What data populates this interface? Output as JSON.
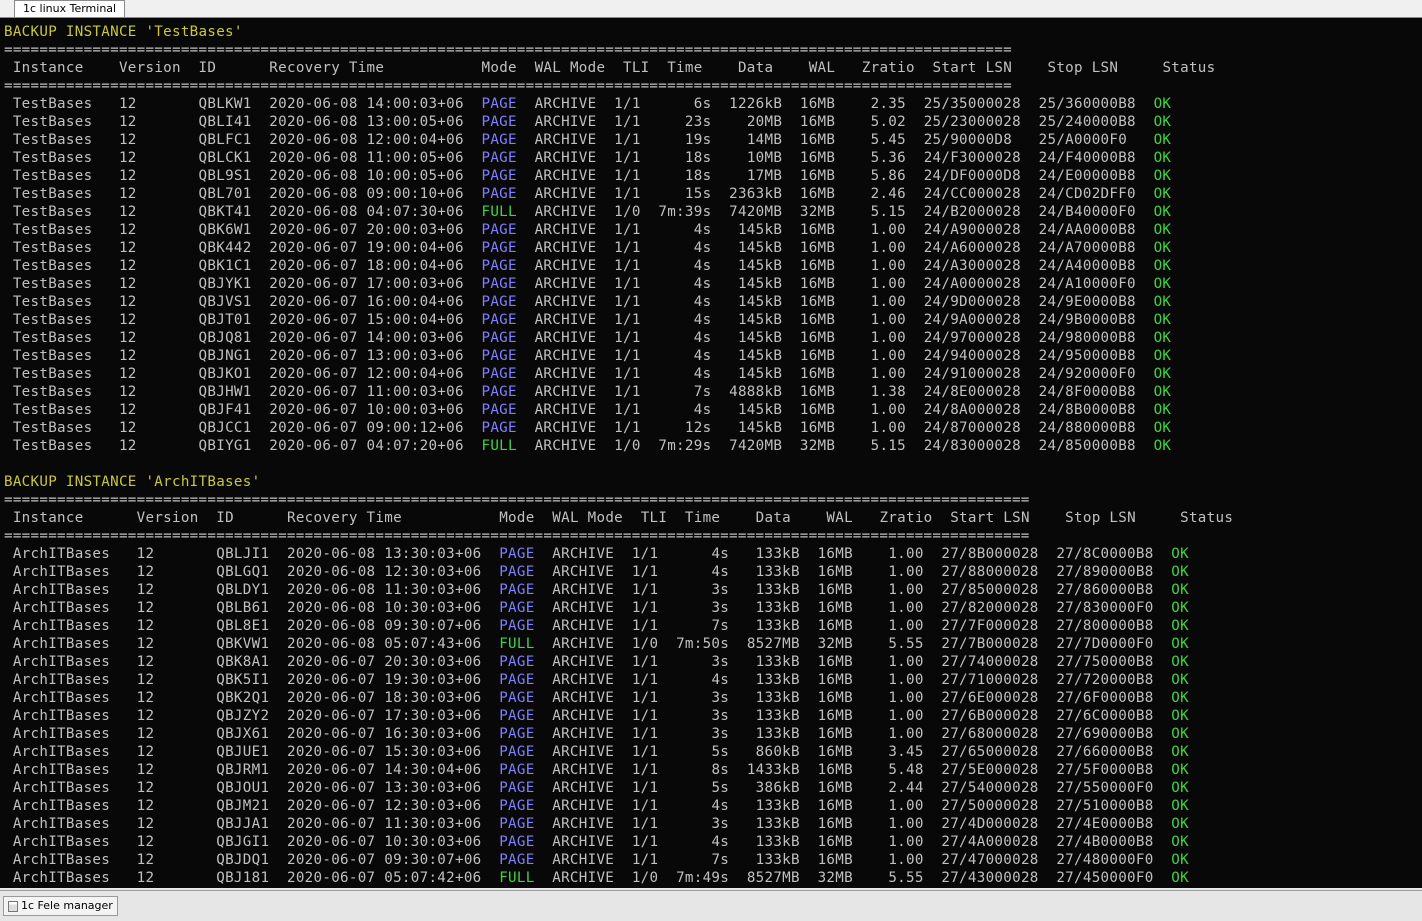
{
  "tabs": {
    "terminal_label": "1c linux Terminal",
    "filemanager_label": "1c Fele manager"
  },
  "colors": {
    "background": "#080808",
    "text": "#c0c0c0",
    "header": "#c9c83a",
    "mode_page": "#8080ff",
    "mode_full": "#3ed63e",
    "status_ok": "#3ed63e"
  },
  "instances": [
    {
      "heading": "BACKUP INSTANCE 'TestBases'",
      "name_width": 10,
      "separator_length": 114,
      "headers": [
        "Instance",
        "Version",
        "ID",
        "Recovery Time",
        "Mode",
        "WAL Mode",
        "TLI",
        "Time",
        "Data",
        "WAL",
        "Zratio",
        "Start LSN",
        "Stop LSN",
        "Status"
      ],
      "rows": [
        [
          "TestBases",
          "12",
          "QBLKW1",
          "2020-06-08 14:00:03+06",
          "PAGE",
          "ARCHIVE",
          "1/1",
          "6s",
          "1226kB",
          "16MB",
          "2.35",
          "25/35000028",
          "25/360000B8",
          "OK"
        ],
        [
          "TestBases",
          "12",
          "QBLI41",
          "2020-06-08 13:00:05+06",
          "PAGE",
          "ARCHIVE",
          "1/1",
          "23s",
          "20MB",
          "16MB",
          "5.02",
          "25/23000028",
          "25/240000B8",
          "OK"
        ],
        [
          "TestBases",
          "12",
          "QBLFC1",
          "2020-06-08 12:00:04+06",
          "PAGE",
          "ARCHIVE",
          "1/1",
          "19s",
          "14MB",
          "16MB",
          "5.45",
          "25/90000D8",
          "25/A0000F0",
          "OK"
        ],
        [
          "TestBases",
          "12",
          "QBLCK1",
          "2020-06-08 11:00:05+06",
          "PAGE",
          "ARCHIVE",
          "1/1",
          "18s",
          "10MB",
          "16MB",
          "5.36",
          "24/F3000028",
          "24/F40000B8",
          "OK"
        ],
        [
          "TestBases",
          "12",
          "QBL9S1",
          "2020-06-08 10:00:05+06",
          "PAGE",
          "ARCHIVE",
          "1/1",
          "18s",
          "17MB",
          "16MB",
          "5.86",
          "24/DF0000D8",
          "24/E00000B8",
          "OK"
        ],
        [
          "TestBases",
          "12",
          "QBL701",
          "2020-06-08 09:00:10+06",
          "PAGE",
          "ARCHIVE",
          "1/1",
          "15s",
          "2363kB",
          "16MB",
          "2.46",
          "24/CC000028",
          "24/CD02DFF0",
          "OK"
        ],
        [
          "TestBases",
          "12",
          "QBKT41",
          "2020-06-08 04:07:30+06",
          "FULL",
          "ARCHIVE",
          "1/0",
          "7m:39s",
          "7420MB",
          "32MB",
          "5.15",
          "24/B2000028",
          "24/B40000F0",
          "OK"
        ],
        [
          "TestBases",
          "12",
          "QBK6W1",
          "2020-06-07 20:00:03+06",
          "PAGE",
          "ARCHIVE",
          "1/1",
          "4s",
          "145kB",
          "16MB",
          "1.00",
          "24/A9000028",
          "24/AA0000B8",
          "OK"
        ],
        [
          "TestBases",
          "12",
          "QBK442",
          "2020-06-07 19:00:04+06",
          "PAGE",
          "ARCHIVE",
          "1/1",
          "4s",
          "145kB",
          "16MB",
          "1.00",
          "24/A6000028",
          "24/A70000B8",
          "OK"
        ],
        [
          "TestBases",
          "12",
          "QBK1C1",
          "2020-06-07 18:00:04+06",
          "PAGE",
          "ARCHIVE",
          "1/1",
          "4s",
          "145kB",
          "16MB",
          "1.00",
          "24/A3000028",
          "24/A40000B8",
          "OK"
        ],
        [
          "TestBases",
          "12",
          "QBJYK1",
          "2020-06-07 17:00:03+06",
          "PAGE",
          "ARCHIVE",
          "1/1",
          "4s",
          "145kB",
          "16MB",
          "1.00",
          "24/A0000028",
          "24/A10000F0",
          "OK"
        ],
        [
          "TestBases",
          "12",
          "QBJVS1",
          "2020-06-07 16:00:04+06",
          "PAGE",
          "ARCHIVE",
          "1/1",
          "4s",
          "145kB",
          "16MB",
          "1.00",
          "24/9D000028",
          "24/9E0000B8",
          "OK"
        ],
        [
          "TestBases",
          "12",
          "QBJT01",
          "2020-06-07 15:00:04+06",
          "PAGE",
          "ARCHIVE",
          "1/1",
          "4s",
          "145kB",
          "16MB",
          "1.00",
          "24/9A000028",
          "24/9B0000B8",
          "OK"
        ],
        [
          "TestBases",
          "12",
          "QBJQ81",
          "2020-06-07 14:00:03+06",
          "PAGE",
          "ARCHIVE",
          "1/1",
          "4s",
          "145kB",
          "16MB",
          "1.00",
          "24/97000028",
          "24/980000B8",
          "OK"
        ],
        [
          "TestBases",
          "12",
          "QBJNG1",
          "2020-06-07 13:00:03+06",
          "PAGE",
          "ARCHIVE",
          "1/1",
          "4s",
          "145kB",
          "16MB",
          "1.00",
          "24/94000028",
          "24/950000B8",
          "OK"
        ],
        [
          "TestBases",
          "12",
          "QBJKO1",
          "2020-06-07 12:00:04+06",
          "PAGE",
          "ARCHIVE",
          "1/1",
          "4s",
          "145kB",
          "16MB",
          "1.00",
          "24/91000028",
          "24/920000F0",
          "OK"
        ],
        [
          "TestBases",
          "12",
          "QBJHW1",
          "2020-06-07 11:00:03+06",
          "PAGE",
          "ARCHIVE",
          "1/1",
          "7s",
          "4888kB",
          "16MB",
          "1.38",
          "24/8E000028",
          "24/8F0000B8",
          "OK"
        ],
        [
          "TestBases",
          "12",
          "QBJF41",
          "2020-06-07 10:00:03+06",
          "PAGE",
          "ARCHIVE",
          "1/1",
          "4s",
          "145kB",
          "16MB",
          "1.00",
          "24/8A000028",
          "24/8B0000B8",
          "OK"
        ],
        [
          "TestBases",
          "12",
          "QBJCC1",
          "2020-06-07 09:00:12+06",
          "PAGE",
          "ARCHIVE",
          "1/1",
          "12s",
          "145kB",
          "16MB",
          "1.00",
          "24/87000028",
          "24/880000B8",
          "OK"
        ],
        [
          "TestBases",
          "12",
          "QBIYG1",
          "2020-06-07 04:07:20+06",
          "FULL",
          "ARCHIVE",
          "1/0",
          "7m:29s",
          "7420MB",
          "32MB",
          "5.15",
          "24/83000028",
          "24/850000B8",
          "OK"
        ]
      ]
    },
    {
      "heading": "BACKUP INSTANCE 'ArchITBases'",
      "name_width": 12,
      "separator_length": 116,
      "headers": [
        "Instance",
        "Version",
        "ID",
        "Recovery Time",
        "Mode",
        "WAL Mode",
        "TLI",
        "Time",
        "Data",
        "WAL",
        "Zratio",
        "Start LSN",
        "Stop LSN",
        "Status"
      ],
      "rows": [
        [
          "ArchITBases",
          "12",
          "QBLJI1",
          "2020-06-08 13:30:03+06",
          "PAGE",
          "ARCHIVE",
          "1/1",
          "4s",
          "133kB",
          "16MB",
          "1.00",
          "27/8B000028",
          "27/8C0000B8",
          "OK"
        ],
        [
          "ArchITBases",
          "12",
          "QBLGQ1",
          "2020-06-08 12:30:03+06",
          "PAGE",
          "ARCHIVE",
          "1/1",
          "4s",
          "133kB",
          "16MB",
          "1.00",
          "27/88000028",
          "27/890000B8",
          "OK"
        ],
        [
          "ArchITBases",
          "12",
          "QBLDY1",
          "2020-06-08 11:30:03+06",
          "PAGE",
          "ARCHIVE",
          "1/1",
          "3s",
          "133kB",
          "16MB",
          "1.00",
          "27/85000028",
          "27/860000B8",
          "OK"
        ],
        [
          "ArchITBases",
          "12",
          "QBLB61",
          "2020-06-08 10:30:03+06",
          "PAGE",
          "ARCHIVE",
          "1/1",
          "3s",
          "133kB",
          "16MB",
          "1.00",
          "27/82000028",
          "27/830000F0",
          "OK"
        ],
        [
          "ArchITBases",
          "12",
          "QBL8E1",
          "2020-06-08 09:30:07+06",
          "PAGE",
          "ARCHIVE",
          "1/1",
          "7s",
          "133kB",
          "16MB",
          "1.00",
          "27/7F000028",
          "27/800000B8",
          "OK"
        ],
        [
          "ArchITBases",
          "12",
          "QBKVW1",
          "2020-06-08 05:07:43+06",
          "FULL",
          "ARCHIVE",
          "1/0",
          "7m:50s",
          "8527MB",
          "32MB",
          "5.55",
          "27/7B000028",
          "27/7D0000F0",
          "OK"
        ],
        [
          "ArchITBases",
          "12",
          "QBK8A1",
          "2020-06-07 20:30:03+06",
          "PAGE",
          "ARCHIVE",
          "1/1",
          "3s",
          "133kB",
          "16MB",
          "1.00",
          "27/74000028",
          "27/750000B8",
          "OK"
        ],
        [
          "ArchITBases",
          "12",
          "QBK5I1",
          "2020-06-07 19:30:03+06",
          "PAGE",
          "ARCHIVE",
          "1/1",
          "4s",
          "133kB",
          "16MB",
          "1.00",
          "27/71000028",
          "27/720000B8",
          "OK"
        ],
        [
          "ArchITBases",
          "12",
          "QBK2Q1",
          "2020-06-07 18:30:03+06",
          "PAGE",
          "ARCHIVE",
          "1/1",
          "3s",
          "133kB",
          "16MB",
          "1.00",
          "27/6E000028",
          "27/6F0000B8",
          "OK"
        ],
        [
          "ArchITBases",
          "12",
          "QBJZY2",
          "2020-06-07 17:30:03+06",
          "PAGE",
          "ARCHIVE",
          "1/1",
          "3s",
          "133kB",
          "16MB",
          "1.00",
          "27/6B000028",
          "27/6C0000B8",
          "OK"
        ],
        [
          "ArchITBases",
          "12",
          "QBJX61",
          "2020-06-07 16:30:03+06",
          "PAGE",
          "ARCHIVE",
          "1/1",
          "3s",
          "133kB",
          "16MB",
          "1.00",
          "27/68000028",
          "27/690000B8",
          "OK"
        ],
        [
          "ArchITBases",
          "12",
          "QBJUE1",
          "2020-06-07 15:30:03+06",
          "PAGE",
          "ARCHIVE",
          "1/1",
          "5s",
          "860kB",
          "16MB",
          "3.45",
          "27/65000028",
          "27/660000B8",
          "OK"
        ],
        [
          "ArchITBases",
          "12",
          "QBJRM1",
          "2020-06-07 14:30:04+06",
          "PAGE",
          "ARCHIVE",
          "1/1",
          "8s",
          "1433kB",
          "16MB",
          "5.48",
          "27/5E000028",
          "27/5F0000B8",
          "OK"
        ],
        [
          "ArchITBases",
          "12",
          "QBJOU1",
          "2020-06-07 13:30:03+06",
          "PAGE",
          "ARCHIVE",
          "1/1",
          "5s",
          "386kB",
          "16MB",
          "2.44",
          "27/54000028",
          "27/550000F0",
          "OK"
        ],
        [
          "ArchITBases",
          "12",
          "QBJM21",
          "2020-06-07 12:30:03+06",
          "PAGE",
          "ARCHIVE",
          "1/1",
          "4s",
          "133kB",
          "16MB",
          "1.00",
          "27/50000028",
          "27/510000B8",
          "OK"
        ],
        [
          "ArchITBases",
          "12",
          "QBJJA1",
          "2020-06-07 11:30:03+06",
          "PAGE",
          "ARCHIVE",
          "1/1",
          "3s",
          "133kB",
          "16MB",
          "1.00",
          "27/4D000028",
          "27/4E0000B8",
          "OK"
        ],
        [
          "ArchITBases",
          "12",
          "QBJGI1",
          "2020-06-07 10:30:03+06",
          "PAGE",
          "ARCHIVE",
          "1/1",
          "4s",
          "133kB",
          "16MB",
          "1.00",
          "27/4A000028",
          "27/4B0000B8",
          "OK"
        ],
        [
          "ArchITBases",
          "12",
          "QBJDQ1",
          "2020-06-07 09:30:07+06",
          "PAGE",
          "ARCHIVE",
          "1/1",
          "7s",
          "133kB",
          "16MB",
          "1.00",
          "27/47000028",
          "27/480000F0",
          "OK"
        ],
        [
          "ArchITBases",
          "12",
          "QBJ181",
          "2020-06-07 05:07:42+06",
          "FULL",
          "ARCHIVE",
          "1/0",
          "7m:49s",
          "8527MB",
          "32MB",
          "5.55",
          "27/43000028",
          "27/450000F0",
          "OK"
        ]
      ]
    }
  ]
}
